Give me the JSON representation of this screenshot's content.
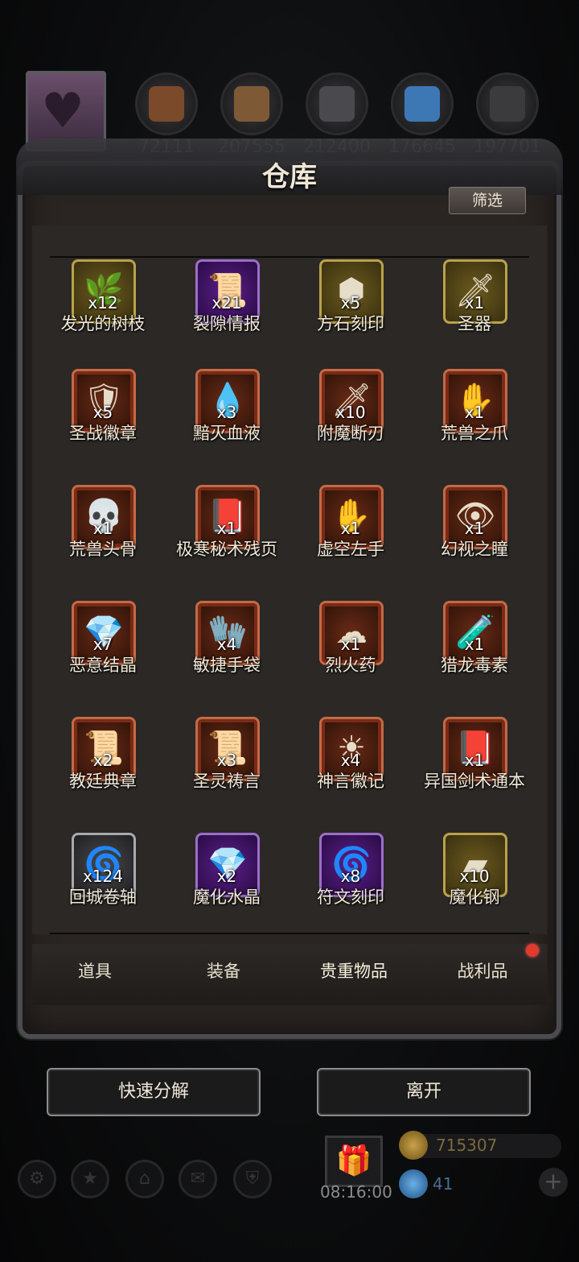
{
  "resources": {
    "portrait_icon": "couple-portrait-icon",
    "items": [
      {
        "icon": "leather-icon",
        "value": "72111",
        "color": "#7a4a2a"
      },
      {
        "icon": "wood-planks-icon",
        "value": "207555",
        "color": "#7d5a35"
      },
      {
        "icon": "metal-ingot-icon",
        "value": "212400",
        "color": "#4a4a4e"
      },
      {
        "icon": "crystal-icon",
        "value": "176645",
        "color": "#3d78b5"
      },
      {
        "icon": "iron-bar-icon",
        "value": "197701",
        "color": "#3b3b3e"
      }
    ]
  },
  "panel": {
    "title": "仓库",
    "filter_label": "筛选"
  },
  "grid": [
    {
      "name": "发光的树枝",
      "count": "x12",
      "rarity": "gold",
      "glyph": "🌿"
    },
    {
      "name": "裂隙情报",
      "count": "x21",
      "rarity": "purple",
      "glyph": "📜"
    },
    {
      "name": "方石刻印",
      "count": "x5",
      "rarity": "gold",
      "glyph": "⬢"
    },
    {
      "name": "圣器",
      "count": "x1",
      "rarity": "gold",
      "glyph": "🗡"
    },
    {
      "name": "圣战徽章",
      "count": "x5",
      "rarity": "red",
      "glyph": "🛡"
    },
    {
      "name": "黯灭血液",
      "count": "x3",
      "rarity": "red",
      "glyph": "💧"
    },
    {
      "name": "附魔断刃",
      "count": "x10",
      "rarity": "red",
      "glyph": "🗡"
    },
    {
      "name": "荒兽之爪",
      "count": "x1",
      "rarity": "red",
      "glyph": "✋"
    },
    {
      "name": "荒兽头骨",
      "count": "x1",
      "rarity": "red",
      "glyph": "💀"
    },
    {
      "name": "极寒秘术残页",
      "count": "x1",
      "rarity": "red",
      "glyph": "📕"
    },
    {
      "name": "虚空左手",
      "count": "x1",
      "rarity": "red",
      "glyph": "✋"
    },
    {
      "name": "幻视之瞳",
      "count": "x1",
      "rarity": "red",
      "glyph": "👁"
    },
    {
      "name": "恶意结晶",
      "count": "x7",
      "rarity": "red",
      "glyph": "💎"
    },
    {
      "name": "敏捷手袋",
      "count": "x4",
      "rarity": "red",
      "glyph": "🧤"
    },
    {
      "name": "烈火药",
      "count": "x1",
      "rarity": "red",
      "glyph": "☁"
    },
    {
      "name": "猎龙毒素",
      "count": "x1",
      "rarity": "red",
      "glyph": "🧪"
    },
    {
      "name": "教廷典章",
      "count": "x2",
      "rarity": "red",
      "glyph": "📜"
    },
    {
      "name": "圣灵祷言",
      "count": "x3",
      "rarity": "red",
      "glyph": "📜"
    },
    {
      "name": "神言徽记",
      "count": "x4",
      "rarity": "red",
      "glyph": "☀"
    },
    {
      "name": "异国剑术通本",
      "count": "x1",
      "rarity": "red",
      "glyph": "📕"
    },
    {
      "name": "回城卷轴",
      "count": "x124",
      "rarity": "gray",
      "glyph": "🌀"
    },
    {
      "name": "魔化水晶",
      "count": "x2",
      "rarity": "purple",
      "glyph": "💎"
    },
    {
      "name": "符文刻印",
      "count": "x8",
      "rarity": "purple",
      "glyph": "🌀"
    },
    {
      "name": "魔化钢",
      "count": "x10",
      "rarity": "gold",
      "glyph": "▰"
    }
  ],
  "tabs": [
    {
      "label": "道具",
      "active": false
    },
    {
      "label": "装备",
      "active": false
    },
    {
      "label": "贵重物品",
      "active": true
    },
    {
      "label": "战利品",
      "active": false,
      "notification": true
    }
  ],
  "actions": {
    "quick_decompose": "快速分解",
    "leave": "离开"
  },
  "hud": {
    "icons": [
      "gear-icon",
      "star-icon",
      "building-icon",
      "mail-icon",
      "shield-icon"
    ],
    "gift_icon": "gift-icon",
    "timer": "08:16:00",
    "gold": "715307",
    "gems": "41",
    "plus_label": "+"
  },
  "colors": {
    "rarity_gold": "#b9a24a",
    "rarity_purple": "#9b6ec9",
    "rarity_red": "#c36a45",
    "rarity_gray": "#a8a8ae",
    "notification": "#e23a2e"
  }
}
